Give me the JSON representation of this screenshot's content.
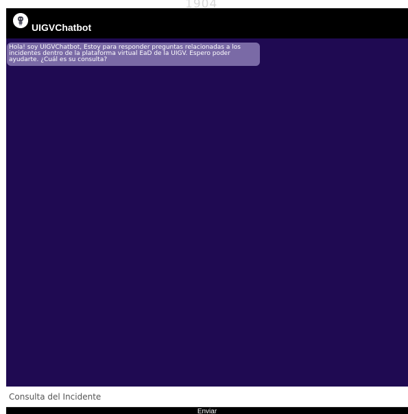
{
  "watermark": {
    "text": "1904"
  },
  "header": {
    "title": "UIGVChatbot",
    "avatar_icon": "robot-icon"
  },
  "messages": [
    {
      "sender": "bot",
      "text": "Hola! soy UIGVChatbot, Estoy para responder preguntas relacionadas a los incidentes dentro de la plataforma virtual EaD de la UIGV. Espero poder ayudarte. ¿Cuál es su consulta?"
    }
  ],
  "input": {
    "placeholder": "Consulta del Incidente",
    "value": ""
  },
  "send_button": {
    "label": "Enviar"
  },
  "colors": {
    "header_bg": "#000000",
    "chat_bg": "#1f0a52",
    "bot_bubble": "#7a6aa6",
    "text": "#ffffff"
  }
}
